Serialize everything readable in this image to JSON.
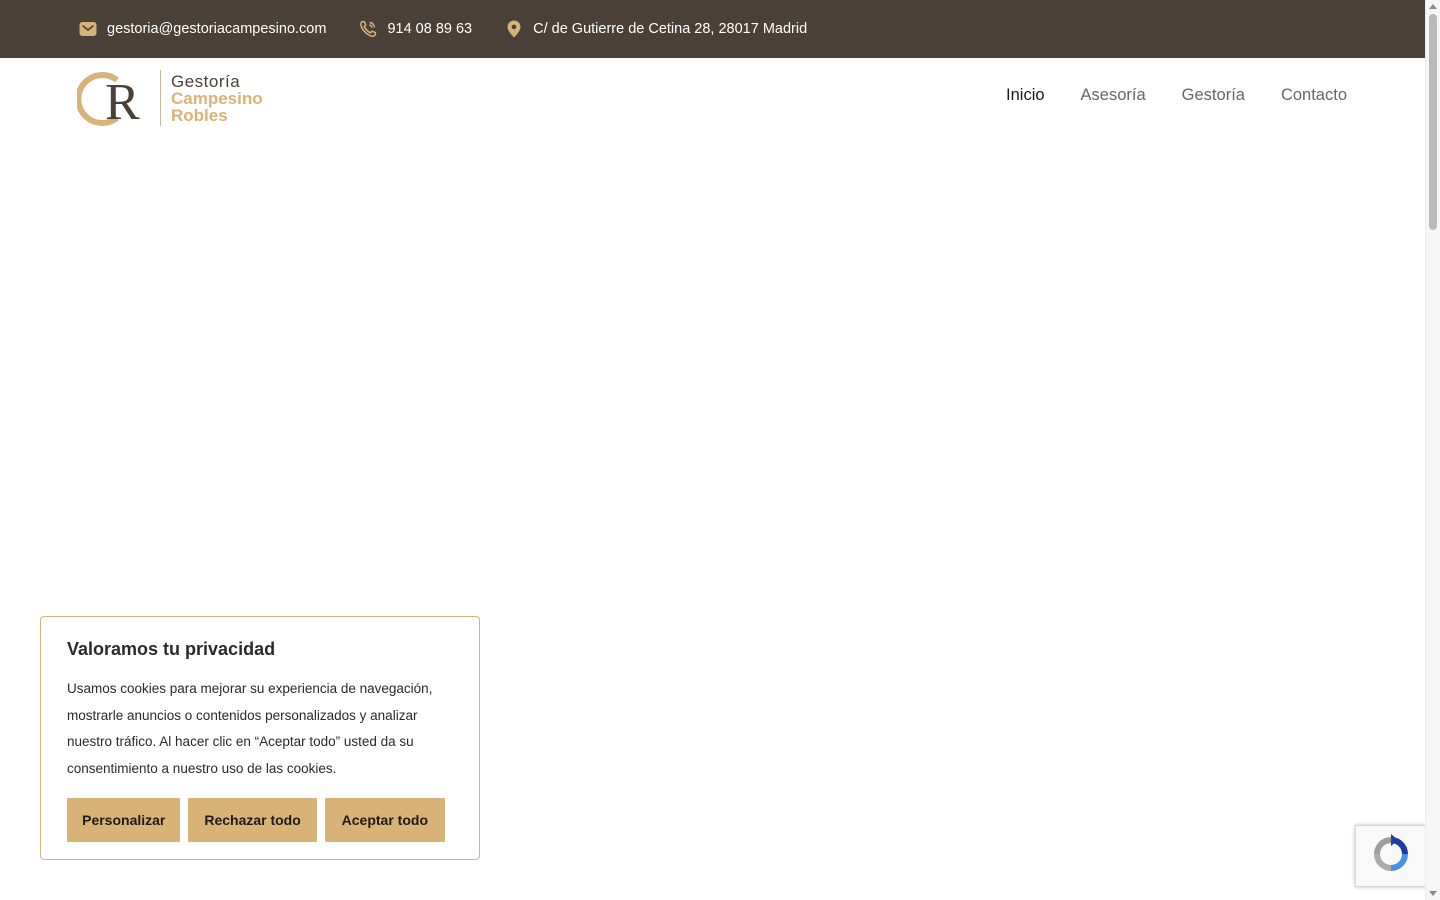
{
  "topbar": {
    "email": "gestoria@gestoriacampesino.com",
    "phone": "914 08 89 63",
    "address": "C/ de Gutierre de Cetina 28, 28017 Madrid",
    "icons": [
      "mail-icon",
      "phone-icon",
      "location-pin-icon"
    ],
    "background": "#4a4038",
    "icon_color": "#d7b377"
  },
  "logo": {
    "line1": "Gestoría",
    "line2": "Campesino",
    "line3": "Robles",
    "monogram_c": "C",
    "monogram_r": "R"
  },
  "nav": {
    "items": [
      "Inicio",
      "Asesoría",
      "Gestoría",
      "Contacto"
    ],
    "active": "Inicio"
  },
  "cookie_banner": {
    "title": "Valoramos tu privacidad",
    "text": "Usamos cookies para mejorar su experiencia de navegación, mostrarle anuncios o contenidos personalizados y analizar nuestro tráfico. Al hacer clic en “Aceptar todo” usted da su consentimiento a nuestro uso de las cookies.",
    "buttons": {
      "customize": "Personalizar",
      "reject": "Rechazar todo",
      "accept": "Aceptar todo"
    },
    "accent": "#d7b377"
  },
  "recaptcha": {
    "icon": "recaptcha-icon"
  }
}
